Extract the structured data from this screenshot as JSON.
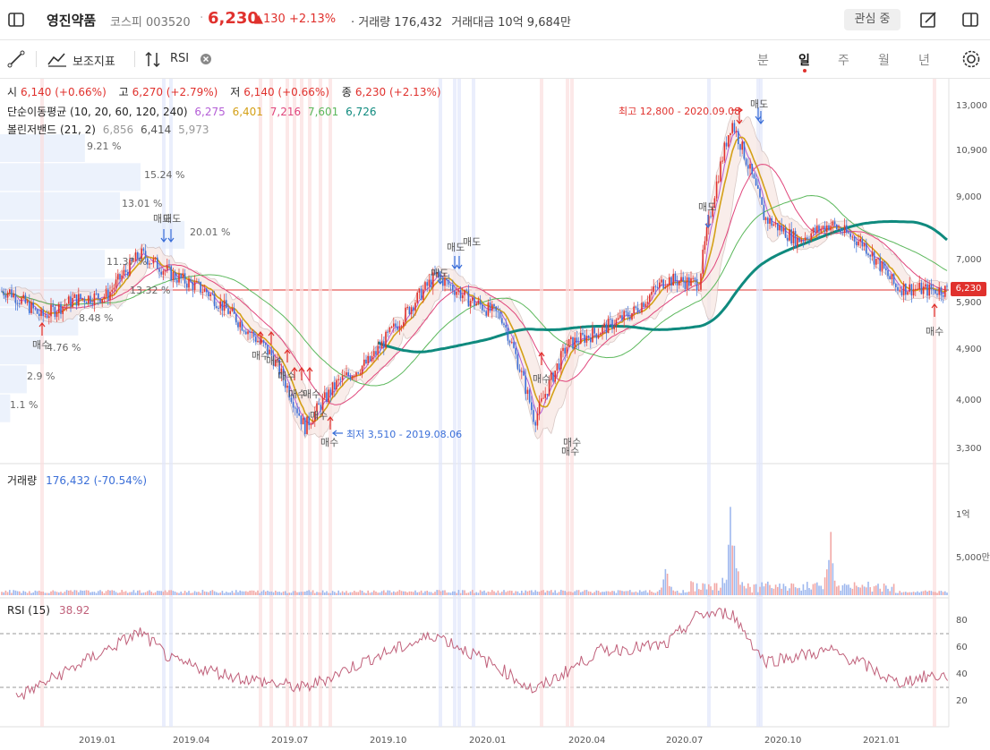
{
  "header": {
    "name": "영진약품",
    "market": "코스피",
    "code": "003520",
    "price": "6,230",
    "change": "▲130",
    "change_pct": "+2.13%",
    "volume_text": "· 거래량 176,432",
    "amount_text": "거래대금 10억 9,684만",
    "watch_label": "관심 중"
  },
  "toolbar": {
    "indicator_label": "보조지표",
    "rsi_label": "RSI",
    "periods": [
      "분",
      "일",
      "주",
      "월",
      "년"
    ],
    "active_period": "일"
  },
  "info": {
    "open_label": "시",
    "open": "6,140 (+0.66%)",
    "high_label": "고",
    "high": "6,270 (+2.79%)",
    "low_label": "저",
    "low": "6,140 (+0.66%)",
    "close_label": "종",
    "close": "6,230 (+2.13%)",
    "ma_label": "단순이동평균 (10, 20, 60, 120, 240)",
    "ma_values": [
      "6,275",
      "6,401",
      "7,216",
      "7,601",
      "6,726"
    ],
    "bb_label": "볼린저밴드 (21, 2)",
    "bb_values": [
      "6,856",
      "6,414",
      "5,973"
    ],
    "volume_label": "거래량",
    "volume_value": "176,432 (-70.54%)",
    "rsi_label": "RSI (15)",
    "rsi_value": "38.92"
  },
  "colors": {
    "up": "#e0312d",
    "down": "#3b6fd8",
    "ma10": "#b45ed6",
    "ma20": "#d4a017",
    "ma60": "#e0457b",
    "ma120": "#5cb85c",
    "ma240": "#0f8a7e",
    "rsi": "#c0607a"
  },
  "annotations": {
    "high": "최고 12,800 - 2020.09.08",
    "low": "최저 3,510 - 2019.08.06",
    "current": "6,230",
    "sell": "매도",
    "buy": "매수"
  },
  "volume_profile": [
    "9.21 %",
    "15.24 %",
    "13.01 %",
    "20.01 %",
    "11.37 %",
    "13.32 %",
    "8.48 %",
    "4.76 %",
    "2.9 %",
    "1.1 %"
  ],
  "chart_data": {
    "type": "candlestick",
    "x_ticks": [
      "2019.01",
      "2019.04",
      "2019.07",
      "2019.10",
      "2020.01",
      "2020.04",
      "2020.07",
      "2020.10",
      "2021.01"
    ],
    "y_ticks_price": [
      "13,000",
      "10,900",
      "9,000",
      "7,000",
      "5,900",
      "4,900",
      "4,000",
      "3,300"
    ],
    "y_ticks_volume": [
      "1억",
      "5,000만"
    ],
    "y_ticks_rsi": [
      "80",
      "60",
      "40",
      "20"
    ],
    "price_series": [
      [
        "2018.11",
        6200
      ],
      [
        "2018.12",
        5600
      ],
      [
        "2019.01",
        6000
      ],
      [
        "2019.02",
        6100
      ],
      [
        "2019.03",
        7200
      ],
      [
        "2019.04",
        6600
      ],
      [
        "2019.05",
        6200
      ],
      [
        "2019.06",
        5500
      ],
      [
        "2019.07",
        4800
      ],
      [
        "2019.08",
        3600
      ],
      [
        "2019.09",
        4300
      ],
      [
        "2019.10",
        4700
      ],
      [
        "2019.11",
        5600
      ],
      [
        "2019.12",
        6600
      ],
      [
        "2020.01",
        6000
      ],
      [
        "2020.02",
        5600
      ],
      [
        "2020.03",
        3700
      ],
      [
        "2020.04",
        5000
      ],
      [
        "2020.05",
        5300
      ],
      [
        "2020.06",
        5700
      ],
      [
        "2020.07",
        6500
      ],
      [
        "2020.08",
        6400
      ],
      [
        "2020.09",
        12200
      ],
      [
        "2020.10",
        8300
      ],
      [
        "2020.11",
        7600
      ],
      [
        "2020.12",
        8100
      ],
      [
        "2021.01",
        7500
      ],
      [
        "2021.02",
        6300
      ],
      [
        "2021.03",
        6230
      ]
    ],
    "rsi_series": [
      [
        "2018.11",
        20
      ],
      [
        "2019.01",
        46
      ],
      [
        "2019.03",
        72
      ],
      [
        "2019.04",
        50
      ],
      [
        "2019.06",
        38
      ],
      [
        "2019.08",
        30
      ],
      [
        "2019.10",
        52
      ],
      [
        "2019.12",
        70
      ],
      [
        "2020.02",
        44
      ],
      [
        "2020.03",
        28
      ],
      [
        "2020.05",
        58
      ],
      [
        "2020.07",
        62
      ],
      [
        "2020.08",
        85
      ],
      [
        "2020.09",
        86
      ],
      [
        "2020.10",
        50
      ],
      [
        "2020.12",
        58
      ],
      [
        "2021.01",
        48
      ],
      [
        "2021.02",
        34
      ],
      [
        "2021.03",
        39
      ]
    ],
    "volume_spikes": [
      [
        "2020.07",
        3500
      ],
      [
        "2020.09",
        10500
      ],
      [
        "2020.12",
        6000
      ]
    ]
  }
}
